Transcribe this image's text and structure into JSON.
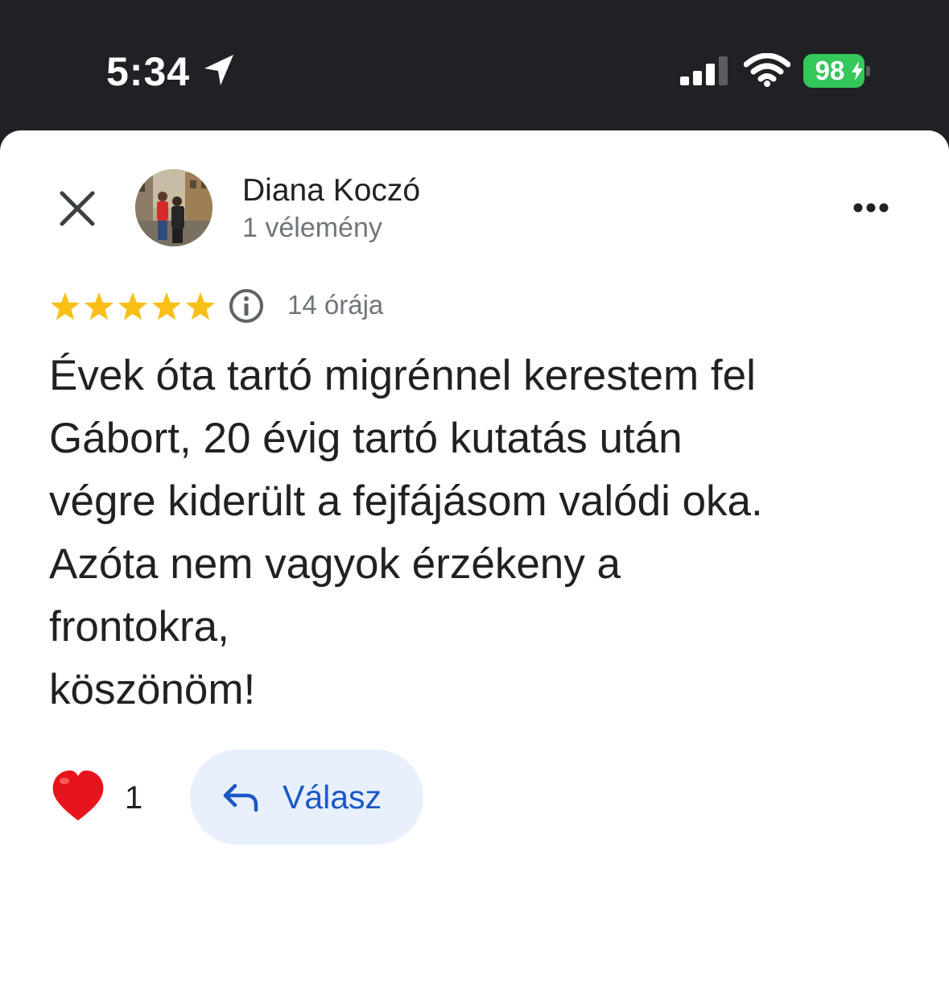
{
  "status_bar": {
    "time": "5:34",
    "battery": "98",
    "icons": [
      "location-arrow-icon",
      "cellular-signal-icon",
      "wifi-icon",
      "battery-charging-icon"
    ]
  },
  "review": {
    "user_name": "Diana Koczó",
    "review_count": "1 vélemény",
    "rating": 5,
    "time_ago": "14 órája",
    "text": "Évek óta tartó migrénnel kerestem fel\nGábort, 20 évig tartó kutatás után\nvégre kiderült a fejfájásom valódi oka.\nAzóta nem vagyok érzékeny a\nfrontokra,\nköszönöm!",
    "like_count": "1",
    "reply_label": "Válasz"
  },
  "colors": {
    "star": "#f9bf15",
    "heart": "#e8141b",
    "reply_bg": "#e8f0fe",
    "reply_text": "#1a57c8",
    "battery": "#34c759"
  }
}
